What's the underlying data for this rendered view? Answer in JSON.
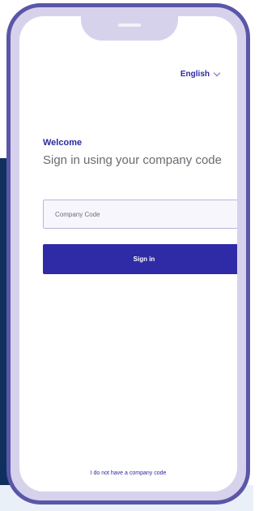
{
  "language": {
    "selected": "English"
  },
  "login": {
    "welcome": "Welcome",
    "heading": "Sign in using your company code",
    "company_code_placeholder": "Company Code",
    "company_code_value": "",
    "sign_in_label": "Sign in",
    "no_code_link": "I do not have a company code"
  },
  "colors": {
    "accent": "#2f2aa5",
    "frame": "#5a56a8",
    "frame_fill": "#d7d2ec",
    "background_dark": "#0f2f5f"
  },
  "icons": {
    "language_dropdown": "chevron-down-icon"
  }
}
